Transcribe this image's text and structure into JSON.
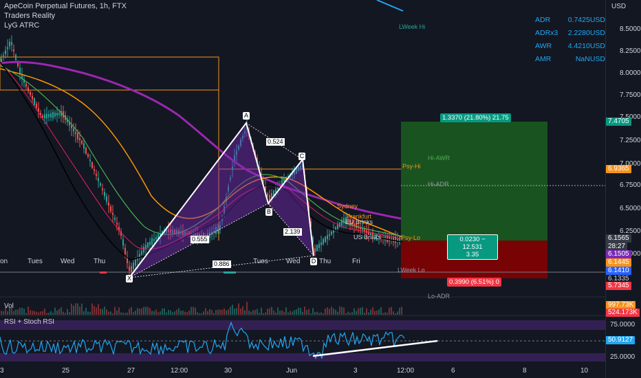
{
  "legend": {
    "symbol": "ApeCoin Perpetual Futures, 1h, FTX",
    "indicator1": "Traders Reality",
    "indicator2": "LyG ATRC"
  },
  "stats": [
    {
      "label": "ADR",
      "value": "0.7425USD"
    },
    {
      "label": "ADRx3",
      "value": "2.2280USD"
    },
    {
      "label": "AWR",
      "value": "4.4210USD"
    },
    {
      "label": "AMR",
      "value": "NaNUSD"
    }
  ],
  "price_axis": {
    "currency": "USD",
    "ticks": [
      "8.5000",
      "8.2500",
      "8.0000",
      "7.7500",
      "7.5000",
      "7.2500",
      "7.0000",
      "6.7500",
      "6.5000",
      "6.2500",
      "6.0000"
    ],
    "badges": [
      {
        "text": "7.4705",
        "color": "#089981"
      },
      {
        "text": "6.9365",
        "color": "#f7931a"
      },
      {
        "text": "6.1565",
        "color": "#363a45"
      },
      {
        "text": "28:27",
        "color": "#363a45"
      },
      {
        "text": "6.1505",
        "color": "#7b2ab8"
      },
      {
        "text": "6.1445",
        "color": "#f7931a"
      },
      {
        "text": "6.1410",
        "color": "#2962ff"
      },
      {
        "text": "6.1335",
        "color": "#131722"
      },
      {
        "text": "5.7345",
        "color": "#f23645"
      }
    ],
    "vol_badges": [
      {
        "text": "997.73K",
        "color": "#f7931a"
      },
      {
        "text": "524.173K",
        "color": "#f23645"
      }
    ],
    "rsi_ticks": [
      "75.0000",
      "25.0000"
    ],
    "rsi_badge": {
      "text": "50.9127",
      "color": "#22a6f2"
    }
  },
  "time_axis": [
    "3",
    "25",
    "27",
    "12:00",
    "30",
    "Jun",
    "3",
    "12:00",
    "6",
    "8",
    "10"
  ],
  "inner_days": [
    "on",
    "Tues",
    "Wed",
    "Thu",
    "Tues",
    "Wed",
    "Thu",
    "Fri"
  ],
  "panels": {
    "volume": "Vol",
    "rsi": "RSI + Stoch RSI"
  },
  "pattern_points": [
    "X",
    "A",
    "B",
    "C",
    "D"
  ],
  "ratios": {
    "xab": "0.555",
    "abc": "0.524",
    "bcd": "2.139",
    "xad": "0.886"
  },
  "levels": {
    "lweek_hi": "LWeek Hi",
    "lweek_lo": "LWeek Lo",
    "psy_hi": "Psy-Hi",
    "psy_lo": "Psy-Lo",
    "hi_awr": "Hi-AWR",
    "hi_adr": "Hi-ADR",
    "sydney": "Sydney",
    "frankfurt": "Frankfurt",
    "eu_brinks": "EU Brinks",
    "us_brinks": "US Brinks",
    "lo_adr": "Lo-ADR"
  },
  "position": {
    "target": "1.3370 (21.80%) 21.75",
    "ratio": "0.0230 − 12.531",
    "ratio2": "3.35",
    "stop": "0.3990 (6.51%) 0"
  },
  "colors": {
    "up": "#26a69a",
    "down": "#ef5350",
    "ema_purple": "#9c27b0",
    "ema_orange": "#ff9800",
    "rsi": "#22a6f2"
  }
}
